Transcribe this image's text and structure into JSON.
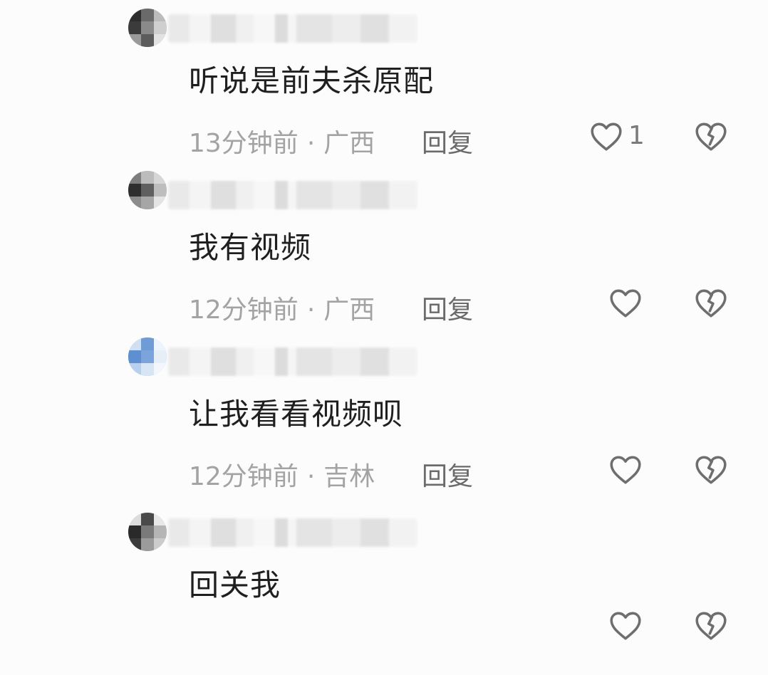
{
  "comments": [
    {
      "text": "听说是前夫杀原配",
      "time": "13分钟前",
      "dot": "·",
      "location": "广西",
      "reply": "回复",
      "likes": "1"
    },
    {
      "text": "我有视频",
      "time": "12分钟前",
      "dot": "·",
      "location": "广西",
      "reply": "回复",
      "likes": ""
    },
    {
      "text": "让我看看视频呗",
      "time": "12分钟前",
      "dot": "·",
      "location": "吉林",
      "reply": "回复",
      "likes": ""
    },
    {
      "text": "回关我",
      "time": "",
      "dot": "",
      "location": "",
      "reply": "",
      "likes": ""
    }
  ],
  "icons": {
    "like": "heart-outline-icon",
    "dislike": "broken-heart-icon"
  },
  "colors": {
    "text": "#1f1f1f",
    "meta": "#a3a3a3",
    "reply": "#6b6b6b",
    "icon": "#6e6e6e",
    "background": "#fcfcfc"
  }
}
